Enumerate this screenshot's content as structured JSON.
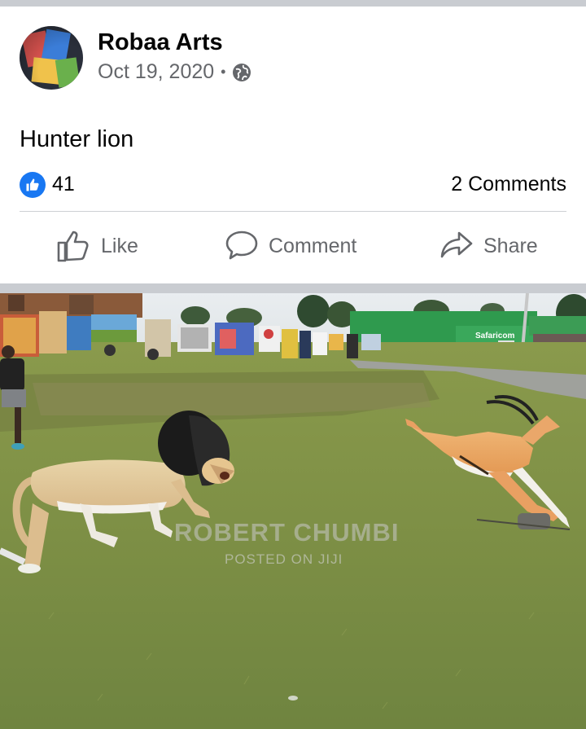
{
  "post": {
    "page_name": "Robaa Arts",
    "date": "Oct 19, 2020",
    "separator": "•",
    "privacy_icon": "globe-icon",
    "caption": "Hunter lion"
  },
  "reactions": {
    "icon": "like-reaction-icon",
    "count": "41",
    "comments": "2 Comments"
  },
  "actions": {
    "like": "Like",
    "comment": "Comment",
    "share": "Share"
  },
  "photo": {
    "watermark_main": "ROBERT CHUMBI",
    "watermark_sub": "POSTED ON JIJI",
    "sign_text": "Safaricom"
  },
  "colors": {
    "brand_blue": "#1877f2",
    "secondary_text": "#65676b",
    "divider": "#c9ccd1"
  }
}
